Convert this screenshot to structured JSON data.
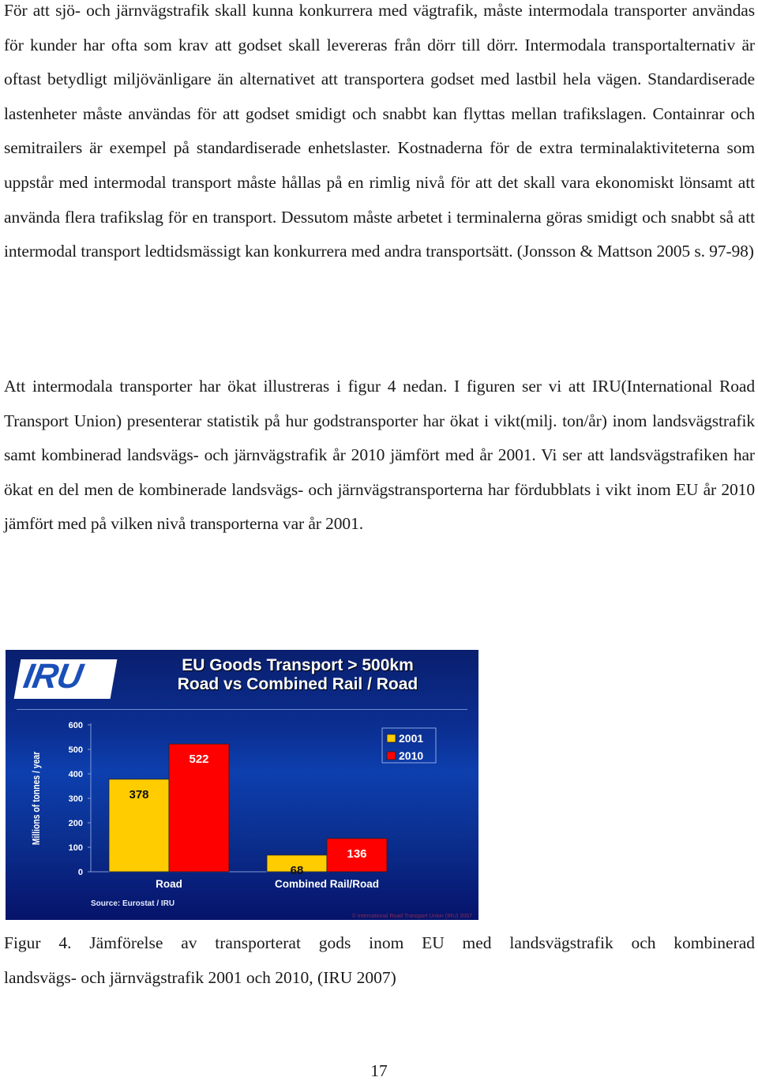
{
  "document": {
    "paragraphs": [
      "För att sjö- och järnvägstrafik skall kunna konkurrera med vägtrafik, måste intermodala trans­porter användas för kunder har ofta som krav att godset skall levereras från dörr till dörr. In­termodala transportalternativ är oftast betydligt miljövänligare än alternativet att transportera godset med lastbil hela vägen. Standardiserade lastenheter måste användas för att godset smi­digt och snabbt kan flyttas mellan trafikslagen. Containrar och semitrailers är exempel på standardiserade enhetslaster. Kostnaderna för de extra terminalaktiviteterna som uppstår med intermodal transport måste hållas på en rimlig nivå för att det skall vara ekonomiskt lönsamt att använda flera trafikslag för en transport. Dessutom måste arbetet i terminalerna göras smi­digt och snabbt så att intermodal transport ledtidsmässigt kan konkurrera med andra trans­portsätt. (Jonsson & Mattson 2005 s. 97-98)",
      "Att intermodala transporter har ökat illustreras i figur 4 nedan. I figuren ser vi att IRU(International Road Transport Union) presenterar statistik på hur godstransporter har ökat i vikt(milj. ton/år) inom landsvägstrafik samt kombinerad landsvägs- och järnvägstrafik år 2010 jämfört med år 2001. Vi ser att landsvägstrafiken har ökat en del men de kombinerade landsvägs- och järnvägstransporterna har fördubblats i vikt inom EU år 2010 jämfört med på vilken nivå transporterna var år 2001."
    ],
    "caption_line1": "Figur 4. Jämförelse av transporterat gods inom EU med landsvägstrafik och kombinerad",
    "caption_line2": "landsvägs- och järnvägstrafik 2001 och 2010, (IRU 2007)",
    "page_number": "17"
  },
  "figure": {
    "logo_text": "IRU",
    "title_line1": "EU Goods Transport > 500km",
    "title_line2": "Road vs Combined Rail / Road",
    "source": "Source: Eurostat / IRU",
    "copyright": "© International Road Transport Union (IRU) 2007"
  },
  "chart_data": {
    "type": "bar",
    "title": "EU Goods Transport > 500km — Road vs Combined Rail / Road",
    "xlabel": "",
    "ylabel": "Millions of tonnes / year",
    "ylim": [
      0,
      600
    ],
    "yticks": [
      0,
      100,
      200,
      300,
      400,
      500,
      600
    ],
    "categories": [
      "Road",
      "Combined Rail/Road"
    ],
    "series": [
      {
        "name": "2001",
        "color": "#ffcc00",
        "label_color": "#111111",
        "values": [
          378,
          68
        ]
      },
      {
        "name": "2010",
        "color": "#ff0000",
        "label_color": "#ffffff",
        "values": [
          522,
          136
        ]
      }
    ],
    "legend": "top-right",
    "grid": false
  }
}
